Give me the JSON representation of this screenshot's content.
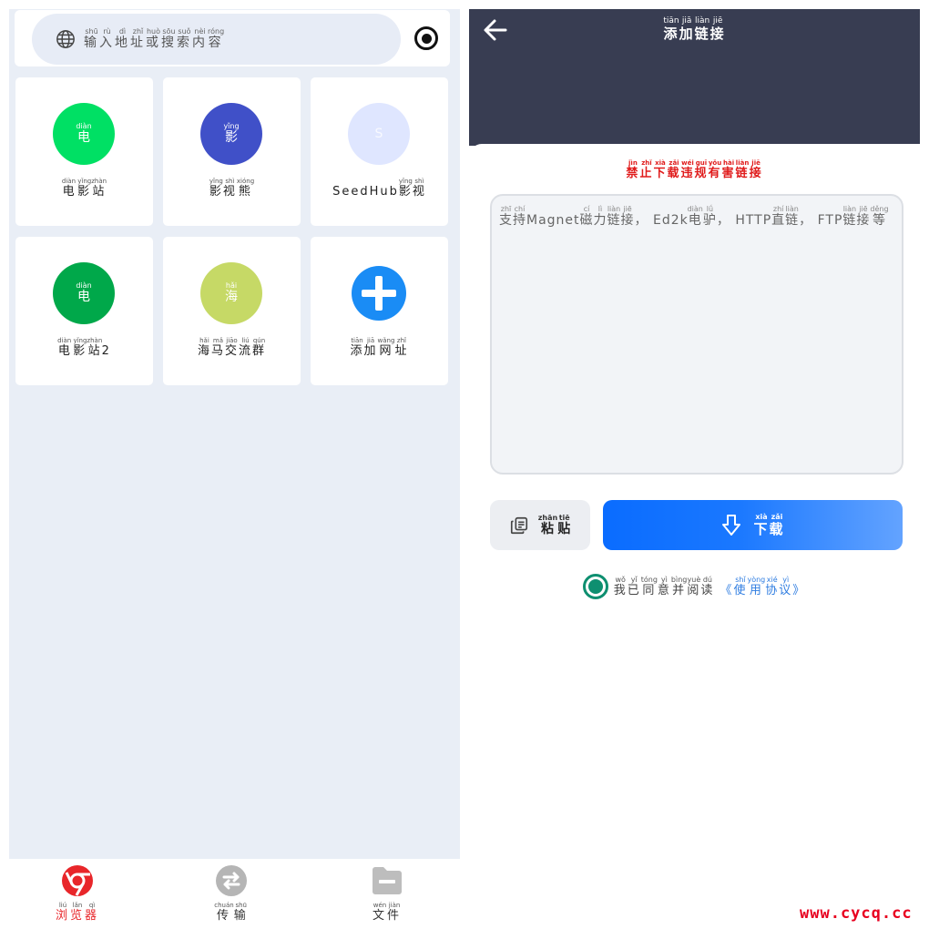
{
  "browser": {
    "search": {
      "placeholder": [
        [
          "输",
          "shū"
        ],
        [
          "入",
          "rù"
        ],
        [
          "地",
          "dì"
        ],
        [
          "址",
          "zhǐ"
        ],
        [
          "或",
          "huò"
        ],
        [
          "搜",
          "sōu"
        ],
        [
          "索",
          "suǒ"
        ],
        [
          "内",
          "nèi"
        ],
        [
          "容",
          "róng"
        ]
      ]
    },
    "tiles": [
      {
        "circle_char": [
          [
            "电",
            "diàn"
          ]
        ],
        "color": "#00e064",
        "label": [
          [
            "电影站",
            "diàn yǐngzhàn"
          ]
        ]
      },
      {
        "circle_char": [
          [
            "影",
            "yǐng"
          ]
        ],
        "color": "#4050c8",
        "label": [
          [
            "影",
            "yǐng"
          ],
          [
            "视",
            "shì"
          ],
          [
            "熊",
            "xióng"
          ]
        ]
      },
      {
        "circle_char": [
          [
            "S",
            ""
          ]
        ],
        "color": "#dfe6ff",
        "label": [
          [
            "SeedHub",
            ""
          ],
          [
            "影",
            "yǐng"
          ],
          [
            "视",
            "shì"
          ]
        ]
      },
      {
        "circle_char": [
          [
            "电",
            "diàn"
          ]
        ],
        "color": "#00a84a",
        "label": [
          [
            "电影站",
            "diàn yǐngzhàn"
          ],
          [
            "2",
            ""
          ]
        ]
      },
      {
        "circle_char": [
          [
            "海",
            "hǎi"
          ]
        ],
        "color": "#c6d966",
        "label": [
          [
            "海",
            "hǎi"
          ],
          [
            "马",
            "mǎ"
          ],
          [
            "交",
            "jiāo"
          ],
          [
            "流",
            "liú"
          ],
          [
            "群",
            "qún"
          ]
        ]
      },
      {
        "icon": "plus-circle-icon",
        "color": "#1a8cf5",
        "label": [
          [
            "添",
            "tiān"
          ],
          [
            "加",
            "jiā"
          ],
          [
            "网",
            "wǎng"
          ],
          [
            "址",
            "zhǐ"
          ]
        ]
      }
    ]
  },
  "bottom_nav": [
    {
      "icon": "browser-icon",
      "label": [
        [
          "浏",
          "liú"
        ],
        [
          "览",
          "lǎn"
        ],
        [
          "器",
          "qì"
        ]
      ],
      "active": true
    },
    {
      "icon": "transfer-icon",
      "label": [
        [
          "传",
          "chuán"
        ],
        [
          "输",
          "shū"
        ]
      ],
      "active": false
    },
    {
      "icon": "folder-icon",
      "label": [
        [
          "文",
          "wén"
        ],
        [
          "件",
          "jiàn"
        ]
      ],
      "active": false
    }
  ],
  "add_link": {
    "title": [
      [
        "添",
        "tiān"
      ],
      [
        "加",
        "jiā"
      ],
      [
        "链",
        "liàn"
      ],
      [
        "接",
        "jiē"
      ]
    ],
    "warning": [
      [
        "禁",
        "jìn"
      ],
      [
        "止",
        "zhǐ"
      ],
      [
        "下",
        "xià"
      ],
      [
        "载",
        "zǎi"
      ],
      [
        "违",
        "wéi"
      ],
      [
        "规",
        "guī"
      ],
      [
        "有",
        "yǒu"
      ],
      [
        "害",
        "hài"
      ],
      [
        "链",
        "liàn"
      ],
      [
        "接",
        "jiē"
      ]
    ],
    "placeholder": [
      [
        "支",
        "zhī"
      ],
      [
        "持",
        "chí"
      ],
      [
        "Magnet",
        ""
      ],
      [
        "磁",
        "cí"
      ],
      [
        "力",
        "lì"
      ],
      [
        "链",
        "liàn"
      ],
      [
        "接",
        "jiē"
      ],
      [
        "， Ed2k",
        ""
      ],
      [
        "电",
        "diàn"
      ],
      [
        "驴",
        "lǘ"
      ],
      [
        "， HTTP",
        ""
      ],
      [
        "直",
        "zhí"
      ],
      [
        "链",
        "liàn"
      ],
      [
        "， FTP",
        ""
      ],
      [
        "链",
        "liàn"
      ],
      [
        "接",
        "jiē"
      ],
      [
        "等",
        "děng"
      ]
    ],
    "paste_label": [
      [
        "粘",
        "zhān"
      ],
      [
        "贴",
        "tiē"
      ]
    ],
    "download_label": [
      [
        "下",
        "xià"
      ],
      [
        "载",
        "zǎi"
      ]
    ],
    "agree_text": [
      [
        "我",
        "wǒ"
      ],
      [
        "已",
        "yǐ"
      ],
      [
        "同",
        "tóng"
      ],
      [
        "意",
        "yì"
      ],
      [
        "并",
        "bìng"
      ],
      [
        "阅",
        "yuè"
      ],
      [
        "读",
        "dú"
      ]
    ],
    "agreement_link": [
      [
        "《",
        ""
      ],
      [
        "使",
        "shǐ"
      ],
      [
        "用",
        "yòng"
      ],
      [
        "协",
        "xié"
      ],
      [
        "议",
        "yì"
      ],
      [
        "》",
        ""
      ]
    ]
  },
  "watermark": "www.cycq.cc"
}
